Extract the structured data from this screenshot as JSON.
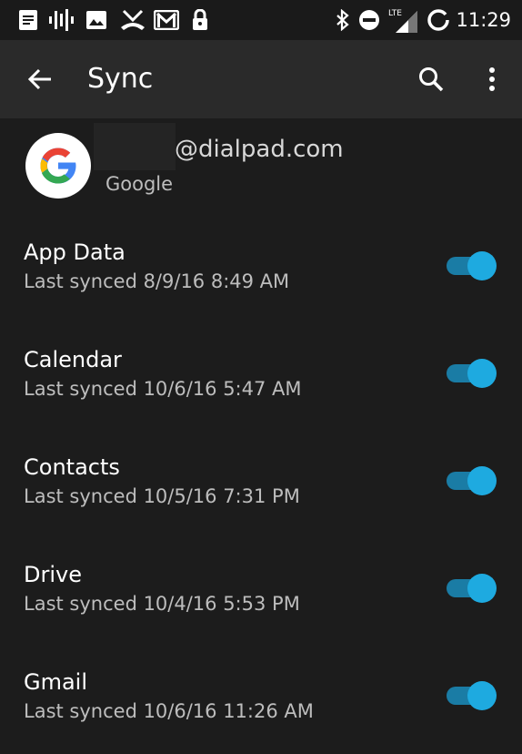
{
  "status_bar": {
    "time": "11:29",
    "network_label": "LTE",
    "icons": [
      "notes-icon",
      "voicemail-icon",
      "image-icon",
      "missed-call-icon",
      "gmail-icon",
      "lock-icon",
      "bluetooth-icon",
      "do-not-disturb-icon",
      "signal-icon",
      "battery-ring-icon"
    ]
  },
  "app_bar": {
    "title": "Sync",
    "back_icon": "arrow-back-icon",
    "search_icon": "search-icon",
    "overflow_icon": "more-vert-icon"
  },
  "account": {
    "email_suffix": "@dialpad.com",
    "type": "Google"
  },
  "sync_items": [
    {
      "label": "App Data",
      "last_synced": "Last synced 8/9/16 8:49 AM",
      "enabled": true
    },
    {
      "label": "Calendar",
      "last_synced": "Last synced 10/6/16 5:47 AM",
      "enabled": true
    },
    {
      "label": "Contacts",
      "last_synced": "Last synced 10/5/16 7:31 PM",
      "enabled": true
    },
    {
      "label": "Drive",
      "last_synced": "Last synced 10/4/16 5:53 PM",
      "enabled": true
    },
    {
      "label": "Gmail",
      "last_synced": "Last synced 10/6/16 11:26 AM",
      "enabled": true
    }
  ],
  "colors": {
    "background": "#1c1c1c",
    "app_bar": "#2a2a2a",
    "toggle_thumb": "#1eaae0",
    "toggle_track": "#1a7ca5"
  }
}
